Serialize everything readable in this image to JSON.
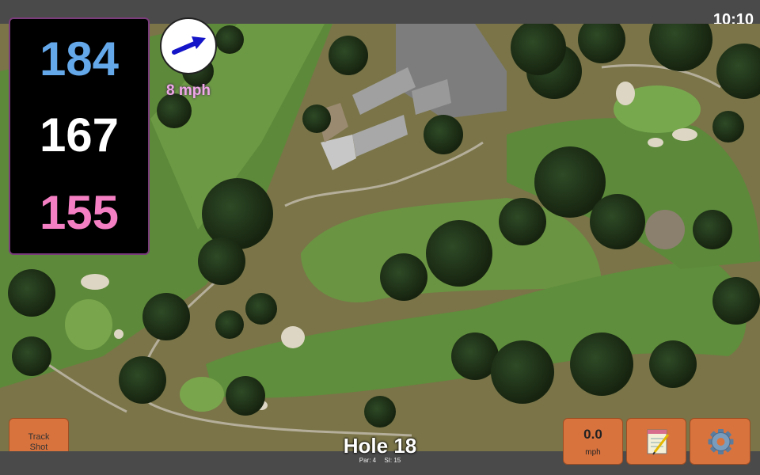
{
  "status": {
    "clock": "10:10"
  },
  "distances": {
    "back": "184",
    "middle": "167",
    "front": "155"
  },
  "wind": {
    "speed_label": "8 mph",
    "icon": "arrow-icon"
  },
  "hole": {
    "title": "Hole 18",
    "par": "Par: 4",
    "stroke_index": "SI: 15"
  },
  "buttons": {
    "track_shot": "Track\nShot",
    "wind_value": "0.0",
    "wind_unit": "mph",
    "notes_icon": "notepad-icon",
    "settings_icon": "gear-icon"
  },
  "colors": {
    "back_distance": "#64a8ea",
    "middle_distance": "#ffffff",
    "front_distance": "#f480c3",
    "button_orange": "#d9733e",
    "panel_border": "#7a3c7a"
  }
}
